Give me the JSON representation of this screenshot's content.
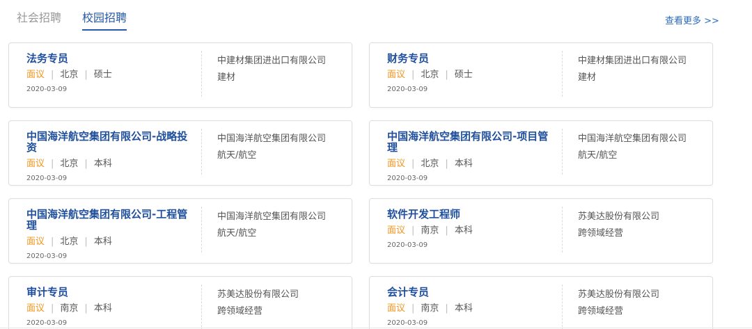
{
  "tabs": [
    {
      "label": "社会招聘",
      "active": false
    },
    {
      "label": "校园招聘",
      "active": true
    }
  ],
  "more_link": "查看更多 >>",
  "colors": {
    "accent": "#2458a8",
    "title": "#1f4f9c",
    "salary": "#f2941a",
    "text": "#555555",
    "border": "#dadde2"
  },
  "jobs": [
    {
      "title": "法务专员",
      "salary": "面议",
      "city": "北京",
      "degree": "硕士",
      "date": "2020-03-09",
      "company": "中建材集团进出口有限公司",
      "industry": "建材"
    },
    {
      "title": "财务专员",
      "salary": "面议",
      "city": "北京",
      "degree": "硕士",
      "date": "2020-03-09",
      "company": "中建材集团进出口有限公司",
      "industry": "建材"
    },
    {
      "title": "中国海洋航空集团有限公司-战略投资",
      "salary": "面议",
      "city": "北京",
      "degree": "本科",
      "date": "2020-03-09",
      "company": "中国海洋航空集团有限公司",
      "industry": "航天/航空"
    },
    {
      "title": "中国海洋航空集团有限公司-项目管理",
      "salary": "面议",
      "city": "北京",
      "degree": "本科",
      "date": "2020-03-09",
      "company": "中国海洋航空集团有限公司",
      "industry": "航天/航空"
    },
    {
      "title": "中国海洋航空集团有限公司-工程管理",
      "salary": "面议",
      "city": "北京",
      "degree": "本科",
      "date": "2020-03-09",
      "company": "中国海洋航空集团有限公司",
      "industry": "航天/航空"
    },
    {
      "title": "软件开发工程师",
      "salary": "面议",
      "city": "南京",
      "degree": "本科",
      "date": "2020-03-09",
      "company": "苏美达股份有限公司",
      "industry": "跨领域经营"
    },
    {
      "title": "审计专员",
      "salary": "面议",
      "city": "南京",
      "degree": "本科",
      "date": "2020-03-09",
      "company": "苏美达股份有限公司",
      "industry": "跨领域经营"
    },
    {
      "title": "会计专员",
      "salary": "面议",
      "city": "南京",
      "degree": "本科",
      "date": "2020-03-09",
      "company": "苏美达股份有限公司",
      "industry": "跨领域经营"
    }
  ]
}
